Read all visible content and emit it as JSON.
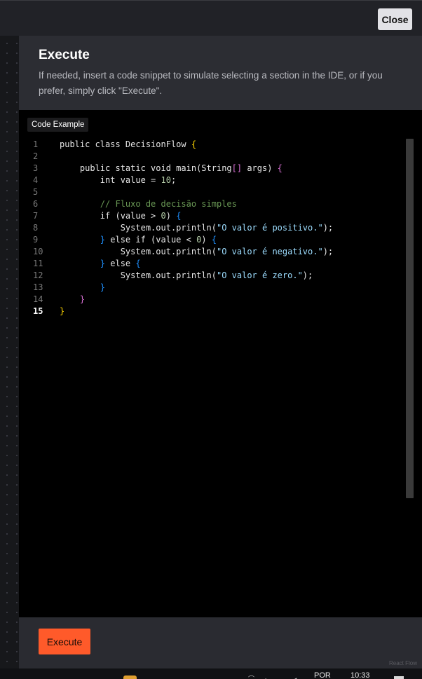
{
  "topbar": {
    "close_label": "Close"
  },
  "panel": {
    "title": "Execute",
    "description": "If needed, insert a code snippet to simulate selecting a section in the IDE, or if you prefer, simply click \"Execute\".",
    "code_label": "Code Example",
    "line_numbers": [
      "1",
      "2",
      "3",
      "4",
      "5",
      "6",
      "7",
      "8",
      "9",
      "10",
      "11",
      "12",
      "13",
      "14",
      "15"
    ],
    "active_line": "15",
    "code": {
      "l1_a": "public class DecisionFlow ",
      "l1_b": "{",
      "l3_a": "    public static void main(String",
      "l3_b": "[]",
      "l3_c": " args) ",
      "l3_d": "{",
      "l4_a": "        int value = ",
      "l4_b": "10",
      "l4_c": ";",
      "l6": "        // Fluxo de decisão simples",
      "l7_a": "        if (value > ",
      "l7_b": "0",
      "l7_c": ") ",
      "l7_d": "{",
      "l8_a": "            System.out.println(",
      "l8_b": "\"O valor é positivo.\"",
      "l8_c": ");",
      "l9_a": "        ",
      "l9_b": "}",
      "l9_c": " else if (value < ",
      "l9_d": "0",
      "l9_e": ") ",
      "l9_f": "{",
      "l10_a": "            System.out.println(",
      "l10_b": "\"O valor é negativo.\"",
      "l10_c": ");",
      "l11_a": "        ",
      "l11_b": "}",
      "l11_c": " else ",
      "l11_d": "{",
      "l12_a": "            System.out.println(",
      "l12_b": "\"O valor é zero.\"",
      "l12_c": ");",
      "l13_a": "        ",
      "l13_b": "}",
      "l14_a": "    ",
      "l14_b": "}",
      "l15": "}"
    },
    "execute_label": "Execute",
    "accent_color": "#ff5a2a"
  },
  "watermark": "React Flow",
  "taskbar": {
    "language": "POR",
    "time": "10:33",
    "tray_glyphs": "⌒ ◦ ▬ ◂"
  }
}
